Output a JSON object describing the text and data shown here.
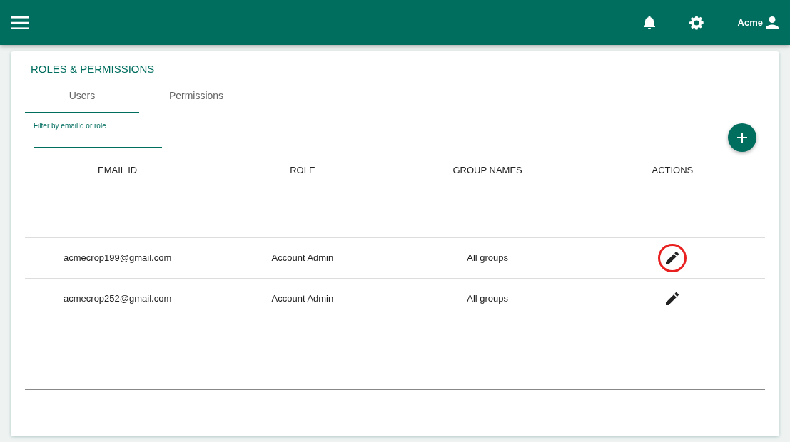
{
  "topbar": {
    "user": "Acme"
  },
  "page": {
    "title": "ROLES & PERMISSIONS"
  },
  "tabs": [
    {
      "label": "Users",
      "selected": true
    },
    {
      "label": "Permissions",
      "selected": false
    }
  ],
  "filter": {
    "label": "Filter by emailId or role"
  },
  "table": {
    "columns": [
      "EMAIL ID",
      "ROLE",
      "GROUP NAMES",
      "ACTIONS"
    ],
    "rows": [
      {
        "email": "acmecrop199@gmail.com",
        "role": "Account Admin",
        "groups": "All groups",
        "highlighted": true
      },
      {
        "email": "acmecrop252@gmail.com",
        "role": "Account Admin",
        "groups": "All groups",
        "highlighted": false
      }
    ]
  }
}
